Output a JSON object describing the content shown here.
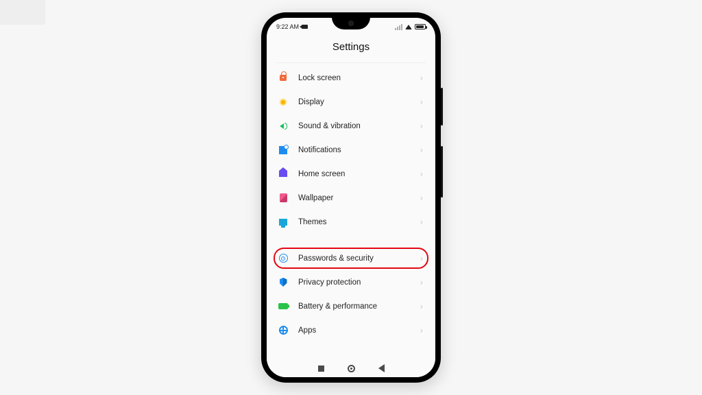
{
  "status": {
    "time": "9:22 AM"
  },
  "page": {
    "title": "Settings"
  },
  "items": [
    {
      "label": "Lock screen"
    },
    {
      "label": "Display"
    },
    {
      "label": "Sound & vibration"
    },
    {
      "label": "Notifications"
    },
    {
      "label": "Home screen"
    },
    {
      "label": "Wallpaper"
    },
    {
      "label": "Themes"
    },
    {
      "label": "Passwords & security"
    },
    {
      "label": "Privacy protection"
    },
    {
      "label": "Battery & performance"
    },
    {
      "label": "Apps"
    }
  ],
  "highlight_index": 7
}
